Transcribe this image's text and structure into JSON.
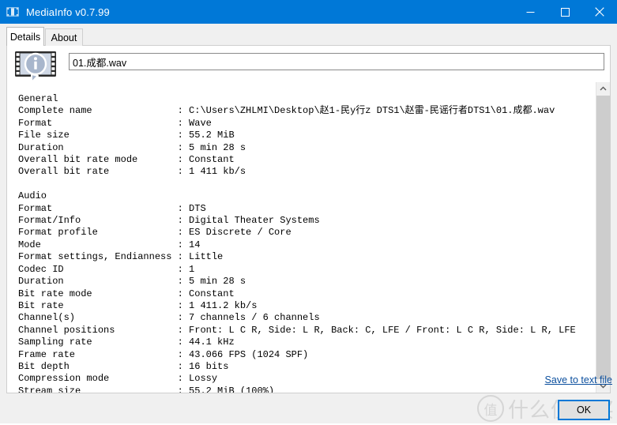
{
  "window": {
    "title": "MediaInfo v0.7.99",
    "icon": "mediainfo-icon",
    "controls": {
      "minimize": "minimize-icon",
      "maximize": "maximize-icon",
      "close": "close-icon"
    }
  },
  "tabs": [
    {
      "label": "Details",
      "active": true
    },
    {
      "label": "About",
      "active": false
    }
  ],
  "header": {
    "logo_icon": "mediainfo-film-info-icon",
    "filename_value": "01.成都.wav",
    "filename_placeholder": ""
  },
  "details": {
    "sections": [
      {
        "title": "General",
        "rows": [
          {
            "label": "Complete name",
            "value": "C:\\Users\\ZHLMI\\Desktop\\赵1-民y行z DTS1\\赵雷-民谣行者DTS1\\01.成都.wav"
          },
          {
            "label": "Format",
            "value": "Wave"
          },
          {
            "label": "File size",
            "value": "55.2 MiB"
          },
          {
            "label": "Duration",
            "value": "5 min 28 s"
          },
          {
            "label": "Overall bit rate mode",
            "value": "Constant"
          },
          {
            "label": "Overall bit rate",
            "value": "1 411 kb/s"
          }
        ]
      },
      {
        "title": "Audio",
        "rows": [
          {
            "label": "Format",
            "value": "DTS"
          },
          {
            "label": "Format/Info",
            "value": "Digital Theater Systems"
          },
          {
            "label": "Format profile",
            "value": "ES Discrete / Core"
          },
          {
            "label": "Mode",
            "value": "14"
          },
          {
            "label": "Format settings, Endianness",
            "value": "Little"
          },
          {
            "label": "Codec ID",
            "value": "1"
          },
          {
            "label": "Duration",
            "value": "5 min 28 s"
          },
          {
            "label": "Bit rate mode",
            "value": "Constant"
          },
          {
            "label": "Bit rate",
            "value": "1 411.2 kb/s"
          },
          {
            "label": "Channel(s)",
            "value": "7 channels / 6 channels"
          },
          {
            "label": "Channel positions",
            "value": "Front: L C R, Side: L R, Back: C, LFE / Front: L C R, Side: L R, LFE"
          },
          {
            "label": "Sampling rate",
            "value": "44.1 kHz"
          },
          {
            "label": "Frame rate",
            "value": "43.066 FPS (1024 SPF)"
          },
          {
            "label": "Bit depth",
            "value": "16 bits"
          },
          {
            "label": "Compression mode",
            "value": "Lossy"
          },
          {
            "label": "Stream size",
            "value": "55.2 MiB (100%)"
          }
        ]
      }
    ]
  },
  "footer": {
    "save_link": "Save to text file",
    "ok_label": "OK"
  },
  "watermark": {
    "badge": "值",
    "text": "什么值得买"
  },
  "colors": {
    "titlebar": "#0078d7",
    "accent": "#0078d7",
    "link": "#0b4f9e",
    "window_bg": "#f0f0f0",
    "client_bg": "#ffffff",
    "scrollbar_thumb": "#cdcdcd"
  }
}
